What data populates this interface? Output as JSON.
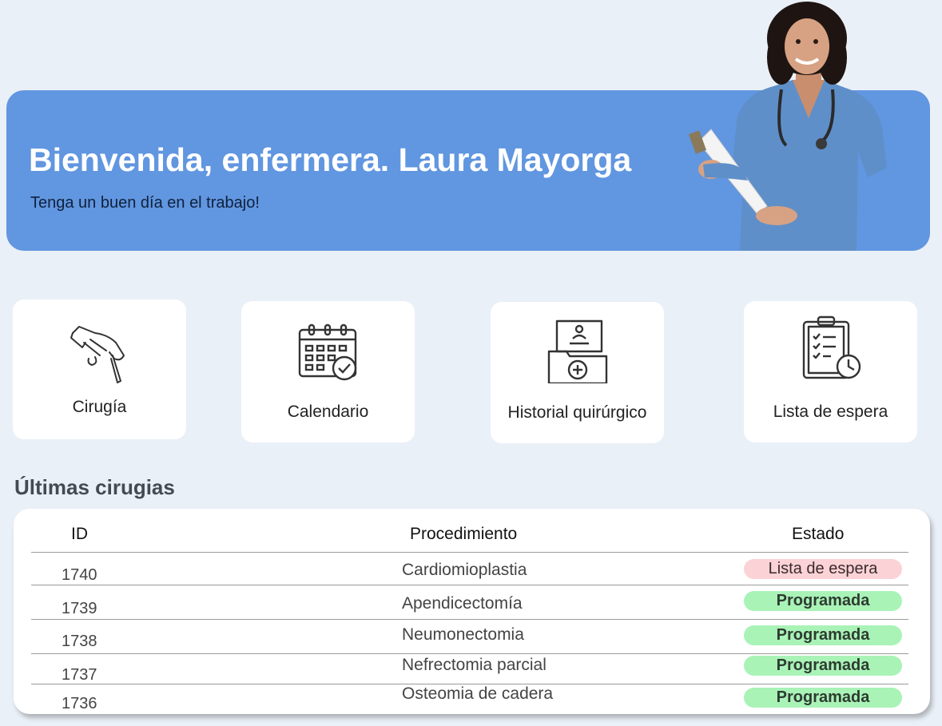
{
  "banner": {
    "title": "Bienvenida, enfermera. Laura Mayorga",
    "subtitle": "Tenga un buen día en el trabajo!"
  },
  "cards": [
    {
      "label": "Cirugía",
      "icon": "scalpel-hand-icon"
    },
    {
      "label": "Calendario",
      "icon": "calendar-check-icon"
    },
    {
      "label": "Historial quirúrgico",
      "icon": "medical-folder-icon"
    },
    {
      "label": "Lista de espera",
      "icon": "clipboard-clock-icon"
    }
  ],
  "section": {
    "title": "Últimas cirugias"
  },
  "table": {
    "headers": {
      "id": "ID",
      "procedure": "Procedimiento",
      "status": "Estado"
    },
    "rows": [
      {
        "id": "1740",
        "procedure": "Cardiomioplastia",
        "status": "Lista de espera"
      },
      {
        "id": "1739",
        "procedure": "Apendicectomía",
        "status": "Programada"
      },
      {
        "id": "1738",
        "procedure": "Neumonectomia",
        "status": "Programada"
      },
      {
        "id": "1737",
        "procedure": "Nefrectomia parcial",
        "status": "Programada"
      },
      {
        "id": "1736",
        "procedure": "Osteomia de cadera",
        "status": "Programada"
      }
    ]
  },
  "colors": {
    "background": "#eaf0f7",
    "banner": "#6196e0",
    "status_waiting": "#fbd3d6",
    "status_scheduled": "#a9f3b7"
  }
}
